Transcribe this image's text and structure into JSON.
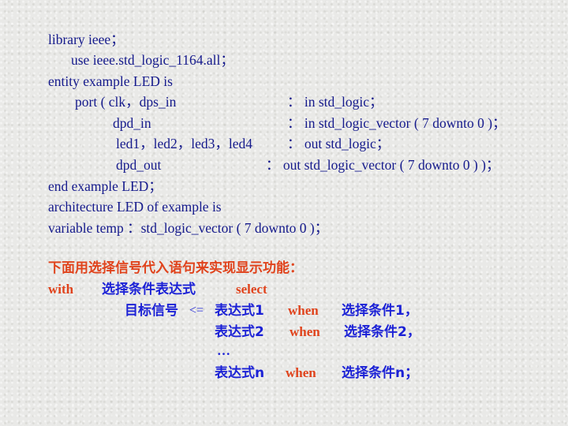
{
  "code": {
    "l1": "library ieee；",
    "l2": "use ieee.std_logic_1164.all；",
    "l3": "entity example LED is",
    "port_l1_left": "port ( clk，dps_in",
    "port_l1_right": "： in std_logic；",
    "port_l2_left": "dpd_in",
    "port_l2_right": "： in std_logic_vector ( 7 downto 0 )；",
    "port_l3_left": "led1，led2，led3，led4",
    "port_l3_right": "： out std_logic；",
    "port_l4_left": "dpd_out",
    "port_l4_right": "： out std_logic_vector ( 7 downto 0 ) )；",
    "l8": "end example LED；",
    "l9": "architecture LED of example is",
    "l10": "variable temp ：std_logic_vector ( 7 downto 0 )；"
  },
  "syntax": {
    "heading": "下面用选择信号代入语句来实现显示功能：",
    "with_kw": "with",
    "select_expr": "选择条件表达式",
    "select_kw": "select",
    "target": "目标信号",
    "assign_op": "<=",
    "rows": [
      {
        "expr": "表达式1",
        "when": "when",
        "cond": "选择条件1，"
      },
      {
        "expr": "表达式2",
        "when": "when",
        "cond": "选择条件2，"
      },
      {
        "expr": "表达式n",
        "when": "when",
        "cond": "选择条件n；"
      }
    ],
    "ellipsis": "…"
  },
  "colors": {
    "code_text": "#151a8c",
    "keyword_red": "#e0431c",
    "syntax_blue": "#1c22d6"
  }
}
